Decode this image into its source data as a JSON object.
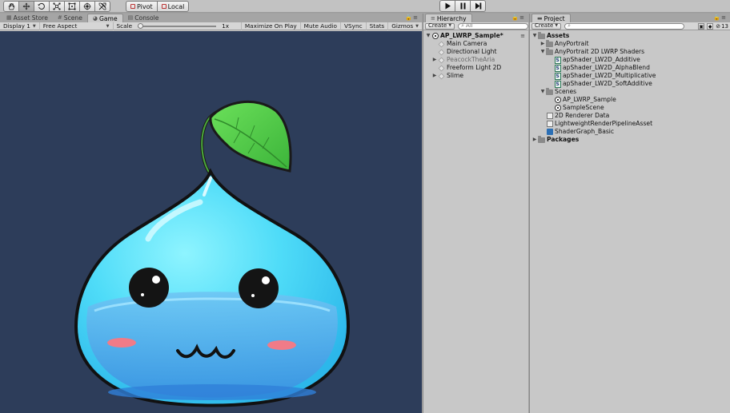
{
  "toolbar": {
    "tools": [
      "hand-tool",
      "move-tool",
      "rotate-tool",
      "scale-tool",
      "rect-tool",
      "transform-tool",
      "custom-tool"
    ],
    "pivot_label": "Pivot",
    "local_label": "Local"
  },
  "game_panel": {
    "tabs": [
      {
        "label": "Asset Store",
        "icon": "store-icon"
      },
      {
        "label": "Scene",
        "icon": "grid-icon"
      },
      {
        "label": "Game",
        "icon": "pacman-icon"
      },
      {
        "label": "Console",
        "icon": "console-icon"
      }
    ],
    "active_tab": "Game",
    "display": "Display 1",
    "aspect": "Free Aspect",
    "scale_label": "Scale",
    "scale_value": "1x",
    "toggles": [
      "Maximize On Play",
      "Mute Audio",
      "VSync",
      "Stats"
    ],
    "gizmos": "Gizmos",
    "background_color": "#2d3d5a"
  },
  "hierarchy": {
    "tab_label": "Hierarchy",
    "create_label": "Create",
    "search_placeholder": "All",
    "scene": "AP_LWRP_Sample*",
    "items": [
      {
        "label": "Main Camera",
        "expandable": false,
        "dim": false
      },
      {
        "label": "Directional Light",
        "expandable": false,
        "dim": false
      },
      {
        "label": "PeacockTheAria",
        "expandable": true,
        "dim": true
      },
      {
        "label": "Freeform Light 2D",
        "expandable": false,
        "dim": false
      },
      {
        "label": "Slime",
        "expandable": true,
        "dim": false
      }
    ]
  },
  "project": {
    "tab_label": "Project",
    "create_label": "Create",
    "badge_count": "13",
    "tree": [
      {
        "label": "Assets",
        "level": 0,
        "arrow": "open",
        "icon": "folder-icon",
        "bold": true
      },
      {
        "label": "AnyPortrait",
        "level": 1,
        "arrow": "closed",
        "icon": "folder-icon"
      },
      {
        "label": "AnyPortrait 2D LWRP Shaders",
        "level": 1,
        "arrow": "open",
        "icon": "folder-icon"
      },
      {
        "label": "apShader_LW2D_Additive",
        "level": 2,
        "arrow": "",
        "icon": "shader-icon"
      },
      {
        "label": "apShader_LW2D_AlphaBlend",
        "level": 2,
        "arrow": "",
        "icon": "shader-icon"
      },
      {
        "label": "apShader_LW2D_Multiplicative",
        "level": 2,
        "arrow": "",
        "icon": "shader-icon"
      },
      {
        "label": "apShader_LW2D_SoftAdditive",
        "level": 2,
        "arrow": "",
        "icon": "shader-icon"
      },
      {
        "label": "Scenes",
        "level": 1,
        "arrow": "open",
        "icon": "folder-icon"
      },
      {
        "label": "AP_LWRP_Sample",
        "level": 2,
        "arrow": "",
        "icon": "unity-scene-icon"
      },
      {
        "label": "SampleScene",
        "level": 2,
        "arrow": "",
        "icon": "unity-scene-icon"
      },
      {
        "label": "2D Renderer Data",
        "level": 1,
        "arrow": "",
        "icon": "asset-icon"
      },
      {
        "label": "LightweightRenderPipelineAsset",
        "level": 1,
        "arrow": "",
        "icon": "asset-icon"
      },
      {
        "label": "ShaderGraph_Basic",
        "level": 1,
        "arrow": "",
        "icon": "shadergraph-icon"
      },
      {
        "label": "Packages",
        "level": 0,
        "arrow": "closed",
        "icon": "folder-icon",
        "bold": true
      }
    ]
  }
}
